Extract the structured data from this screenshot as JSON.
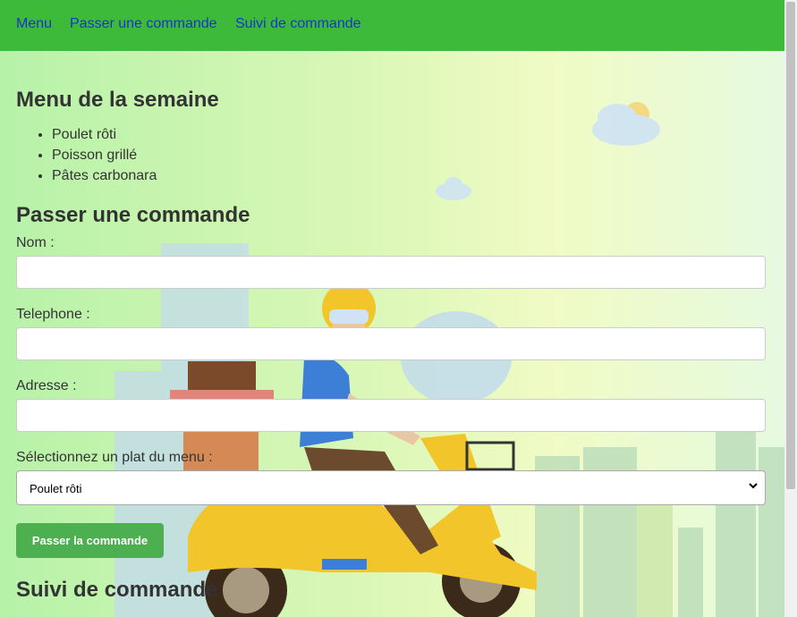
{
  "nav": {
    "items": [
      {
        "label": "Menu"
      },
      {
        "label": "Passer une commande"
      },
      {
        "label": "Suivi de commande"
      }
    ]
  },
  "menu_section": {
    "title": "Menu de la semaine",
    "items": [
      "Poulet rôti",
      "Poisson grillé",
      "Pâtes carbonara"
    ]
  },
  "order_section": {
    "title": "Passer une commande",
    "name_label": "Nom :",
    "phone_label": "Telephone :",
    "address_label": "Adresse :",
    "dish_label": "Sélectionnez un plat du menu :",
    "dish_selected": "Poulet rôti",
    "submit_label": "Passer la commande"
  },
  "tracking_section": {
    "title": "Suivi de commande"
  },
  "colors": {
    "nav_bg": "#3dba3a",
    "nav_link": "#1736c9",
    "button_bg": "#4caf50"
  },
  "icons": {
    "select_arrow": "chevron-down-icon"
  }
}
